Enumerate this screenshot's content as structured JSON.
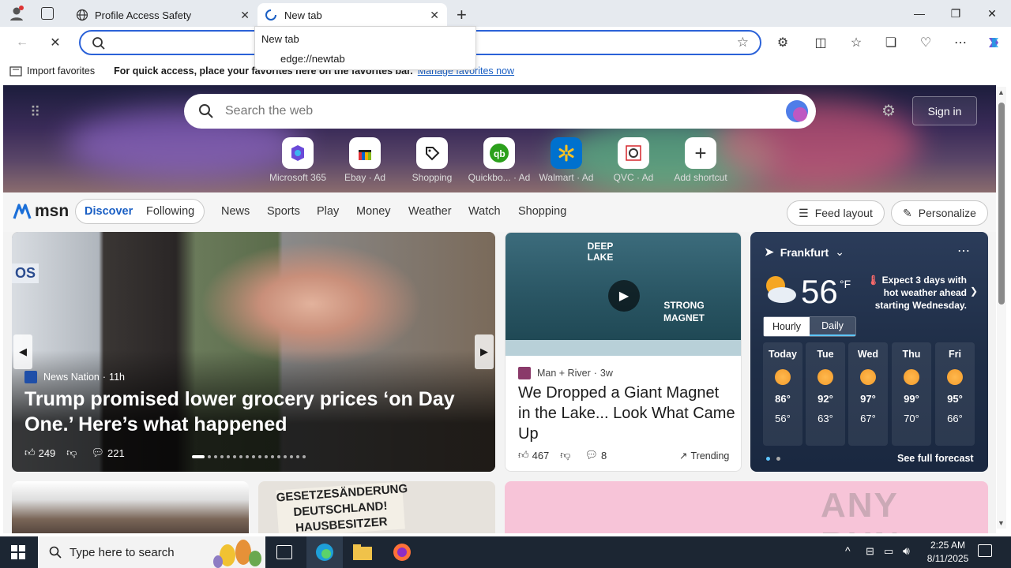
{
  "browser": {
    "tabs": [
      {
        "title": "Profile Access Safety"
      },
      {
        "title": "New tab"
      }
    ],
    "address_placeholder": "",
    "dropdown": {
      "title": "New tab",
      "url": "edge://newtab"
    },
    "favorites_bar": {
      "import_label": "Import favorites",
      "message": "For quick access, place your favorites here on the favorites bar.",
      "link": "Manage favorites now"
    }
  },
  "msn": {
    "search_placeholder": "Search the web",
    "signin_label": "Sign in",
    "shortcuts": [
      {
        "label": "Microsoft 365"
      },
      {
        "label": "Ebay",
        "ad": "Ad"
      },
      {
        "label": "Shopping"
      },
      {
        "label": "Quickbo...",
        "ad": "Ad"
      },
      {
        "label": "Walmart",
        "ad": "Ad"
      },
      {
        "label": "QVC",
        "ad": "Ad"
      },
      {
        "label": "Add shortcut"
      }
    ],
    "logo": "msn",
    "nav_tabs": [
      "Discover",
      "Following"
    ],
    "nav_links": [
      "News",
      "Sports",
      "Play",
      "Money",
      "Weather",
      "Watch",
      "Shopping"
    ],
    "feed_layout_label": "Feed layout",
    "personalize_label": "Personalize",
    "main_story": {
      "source": "News Nation",
      "age": "11h",
      "headline": "Trump promised lower grocery prices ‘on Day One.’ Here’s what happened",
      "likes": "249",
      "comments": "221",
      "image_text": "OS"
    },
    "mid_story": {
      "image_label_1": "DEEP LAKE",
      "image_label_2": "STRONG MAGNET",
      "source": "Man + River",
      "age": "3w",
      "headline": "We Dropped a Giant Magnet in the Lake... Look What Came Up",
      "likes": "467",
      "comments": "8",
      "trending_label": "Trending"
    },
    "weather": {
      "city": "Frankfurt",
      "temp": "56",
      "unit": "°F",
      "alert": "Expect 3 days with hot weather ahead starting Wednesday.",
      "toggle": [
        "Hourly",
        "Daily"
      ],
      "days": [
        {
          "day": "Today",
          "hi": "86°",
          "lo": "56°"
        },
        {
          "day": "Tue",
          "hi": "92°",
          "lo": "63°"
        },
        {
          "day": "Wed",
          "hi": "97°",
          "lo": "67°"
        },
        {
          "day": "Thu",
          "hi": "99°",
          "lo": "70°"
        },
        {
          "day": "Fri",
          "hi": "95°",
          "lo": "66°"
        }
      ],
      "forecast_link": "See full forecast"
    },
    "bottom_card_text": "GESETZESÄNDERUNG DEUTSCHLAND! HAUSBESITZER",
    "watermark": "ANY RUN"
  },
  "taskbar": {
    "search_placeholder": "Type here to search",
    "time": "2:25 AM",
    "date": "8/11/2025"
  }
}
